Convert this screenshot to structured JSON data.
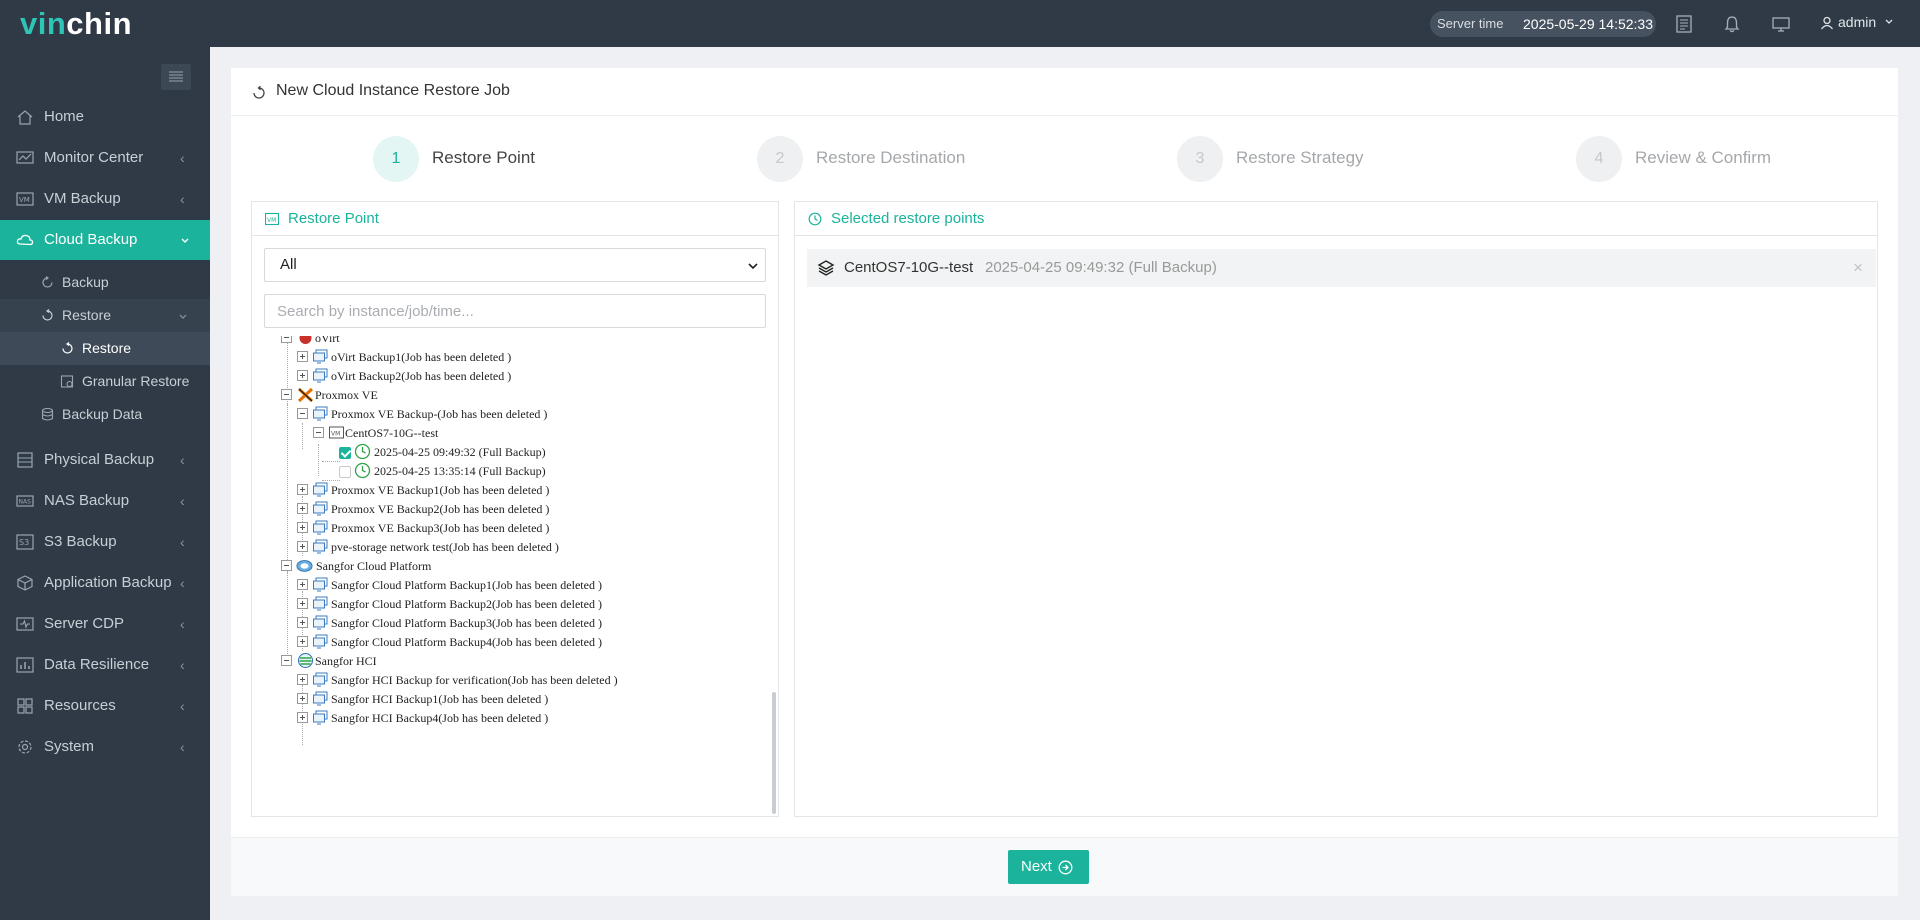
{
  "app": {
    "logo_part1": "vin",
    "logo_part2": "chin"
  },
  "topbar": {
    "server_time_label": "Server time",
    "server_time_value": "2025-05-29 14:52:33",
    "user": "admin"
  },
  "sidebar": {
    "items": [
      {
        "label": "Home"
      },
      {
        "label": "Monitor Center"
      },
      {
        "label": "VM Backup"
      },
      {
        "label": "Cloud Backup"
      },
      {
        "label": "Physical Backup"
      },
      {
        "label": "NAS Backup"
      },
      {
        "label": "S3 Backup"
      },
      {
        "label": "Application Backup"
      },
      {
        "label": "Server CDP"
      },
      {
        "label": "Data Resilience"
      },
      {
        "label": "Resources"
      },
      {
        "label": "System"
      }
    ],
    "cloud_sub": {
      "backup": "Backup",
      "restore": "Restore",
      "restore_child": "Restore",
      "granular": "Granular Restore",
      "backup_data": "Backup Data"
    }
  },
  "page": {
    "title": "New Cloud Instance Restore Job",
    "steps": [
      {
        "num": "1",
        "label": "Restore Point"
      },
      {
        "num": "2",
        "label": "Restore Destination"
      },
      {
        "num": "3",
        "label": "Restore Strategy"
      },
      {
        "num": "4",
        "label": "Review & Confirm"
      }
    ]
  },
  "left_panel": {
    "title": "Restore Point",
    "filter_value": "All",
    "search_placeholder": "Search by instance/job/time...",
    "tree": {
      "ovirt_partial": "oVirt",
      "ovirt_b1": "oVirt Backup1(Job has been deleted )",
      "ovirt_b2": "oVirt Backup2(Job has been deleted )",
      "proxmox": "Proxmox VE",
      "px_backup": "Proxmox VE Backup-(Job has been deleted )",
      "centos": "CentOS7-10G--test",
      "rp1": "2025-04-25 09:49:32 (Full  Backup)",
      "rp2": "2025-04-25 13:35:14 (Full  Backup)",
      "px_b1": "Proxmox VE Backup1(Job has been deleted )",
      "px_b2": "Proxmox VE Backup2(Job has been deleted )",
      "px_b3": "Proxmox VE Backup3(Job has been deleted )",
      "pve_net": "pve-storage network test(Job has been deleted )",
      "sangfor_cp": "Sangfor Cloud Platform",
      "scp_b1": "Sangfor Cloud Platform Backup1(Job has been deleted )",
      "scp_b2": "Sangfor Cloud Platform Backup2(Job has been deleted )",
      "scp_b3": "Sangfor Cloud Platform Backup3(Job has been deleted )",
      "scp_b4": "Sangfor Cloud Platform Backup4(Job has been deleted )",
      "sangfor_hci": "Sangfor HCI",
      "hci_verify": "Sangfor HCI Backup for verification(Job has been deleted )",
      "hci_b1": "Sangfor HCI Backup1(Job has been deleted )",
      "hci_b4": "Sangfor HCI Backup4(Job has been deleted )"
    }
  },
  "right_panel": {
    "title": "Selected restore points",
    "selected": {
      "name": "CentOS7-10G--test",
      "info": "2025-04-25 09:49:32 (Full Backup)",
      "close": "×"
    }
  },
  "footer": {
    "next_label": "Next"
  },
  "colors": {
    "accent": "#1bb39b",
    "sidebar_bg": "#2f3a46"
  }
}
